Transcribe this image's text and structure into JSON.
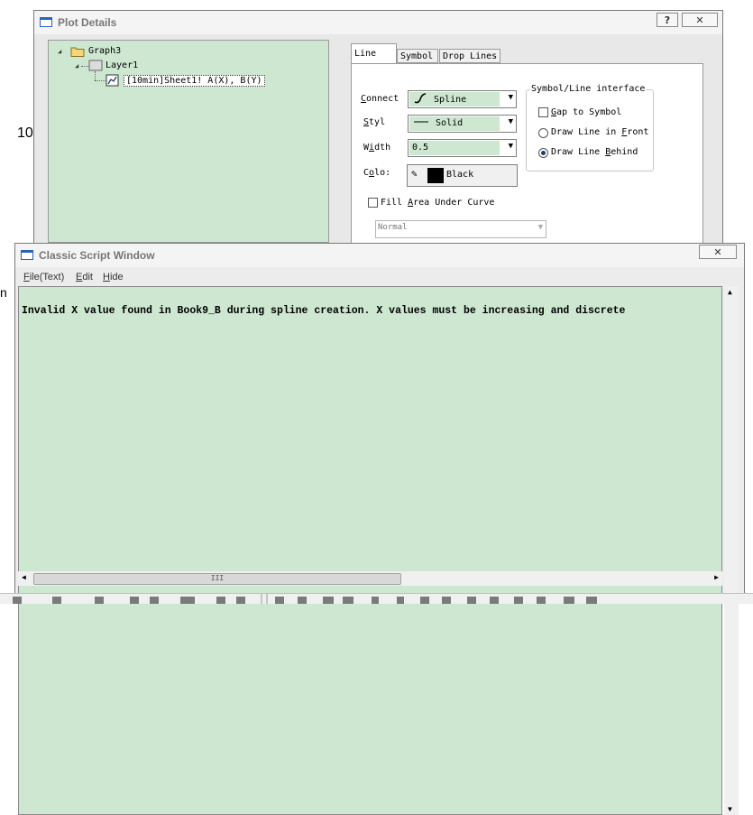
{
  "background": {
    "left_label_1": "10",
    "left_label_2": "n"
  },
  "plot_details": {
    "title": "Plot Details",
    "help_btn": "?",
    "close_btn": "✕",
    "tree": {
      "graph": "Graph3",
      "layer": "Layer1",
      "plot": "[10min]Sheet1! A(X), B(Y)"
    },
    "tabs": [
      "Line",
      "Symbol",
      "Drop Lines"
    ],
    "connect_label_u": "C",
    "connect_label_rest": "onnect",
    "connect_value": "Spline",
    "style_label_u": "S",
    "style_label_rest": "tyl",
    "style_value": "Solid",
    "width_label_pre": "W",
    "width_label_u": "i",
    "width_label_rest": "dth",
    "width_value": "0.5",
    "color_label_pre": "C",
    "color_label_u": "o",
    "color_label_rest": "lo:",
    "color_value": "Black",
    "fill_label_pre": "Fill ",
    "fill_label_u": "A",
    "fill_label_rest": "rea Under Curve",
    "fill_mode": "Normal",
    "interface_title": "Symbol/Line interface",
    "gap_u": "G",
    "gap_rest": "ap to Symbol",
    "front_pre": "Draw Line in ",
    "front_u": "F",
    "front_rest": "ront",
    "behind_pre": "Draw Line ",
    "behind_u": "B",
    "behind_rest": "ehind",
    "colors": {
      "panel_green": "#cde7d1",
      "color_swatch": "#000000"
    }
  },
  "script_window": {
    "title": "Classic Script Window",
    "close_btn": "✕",
    "menu": {
      "file_u": "F",
      "file_rest": "ile(Text)",
      "edit_u": "E",
      "edit_rest": "dit",
      "hide_u": "H",
      "hide_rest": "ide"
    },
    "output": "Invalid X value found in Book9_B during spline creation. X values must be increasing and discrete",
    "hscroll_grip": "III"
  }
}
